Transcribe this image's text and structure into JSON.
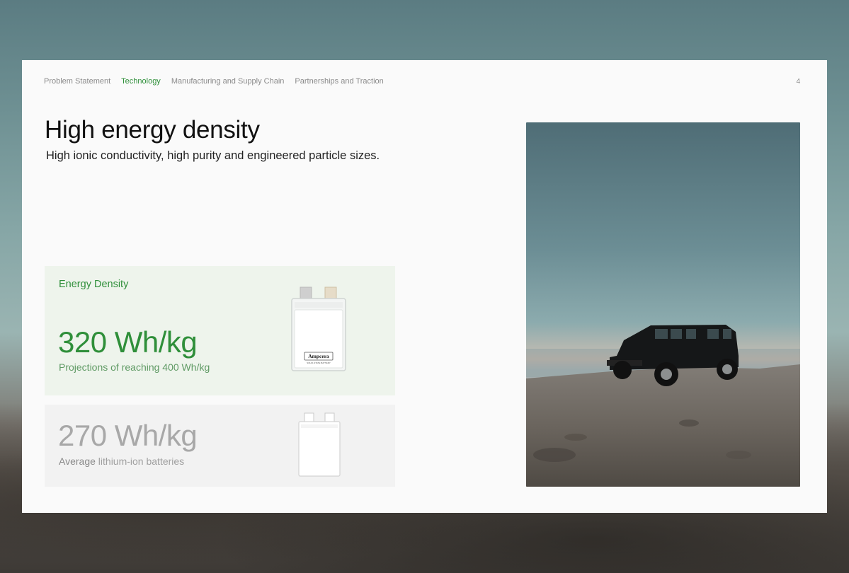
{
  "nav": {
    "items": [
      {
        "label": "Problem Statement",
        "active": false
      },
      {
        "label": "Technology",
        "active": true
      },
      {
        "label": "Manufacturing and Supply Chain",
        "active": false
      },
      {
        "label": "Partnerships and Traction",
        "active": false
      }
    ],
    "page_number": "4"
  },
  "heading": {
    "title": "High energy density",
    "subtitle": "High ionic conductivity, high purity and engineered particle sizes."
  },
  "cards": {
    "featured": {
      "label": "Energy Density",
      "value": "320 Wh/kg",
      "note": "Projections of reaching 400 Wh/kg",
      "battery_brand": "Ampcera",
      "battery_tagline": "SOLID-STATE BATTERY"
    },
    "baseline": {
      "value": "270 Wh/kg",
      "note_emphasis": "Average",
      "note_rest": " lithium-ion batteries"
    }
  },
  "colors": {
    "accent": "#2f8f3a",
    "muted": "#a8a8a8",
    "card_green": "#eef4ec",
    "card_gray": "#f2f2f2"
  },
  "icons": {
    "featured_battery": "pouch-cell-battery-icon",
    "baseline_battery": "pouch-cell-battery-icon",
    "photo": "jeep-on-cliff-photo"
  }
}
